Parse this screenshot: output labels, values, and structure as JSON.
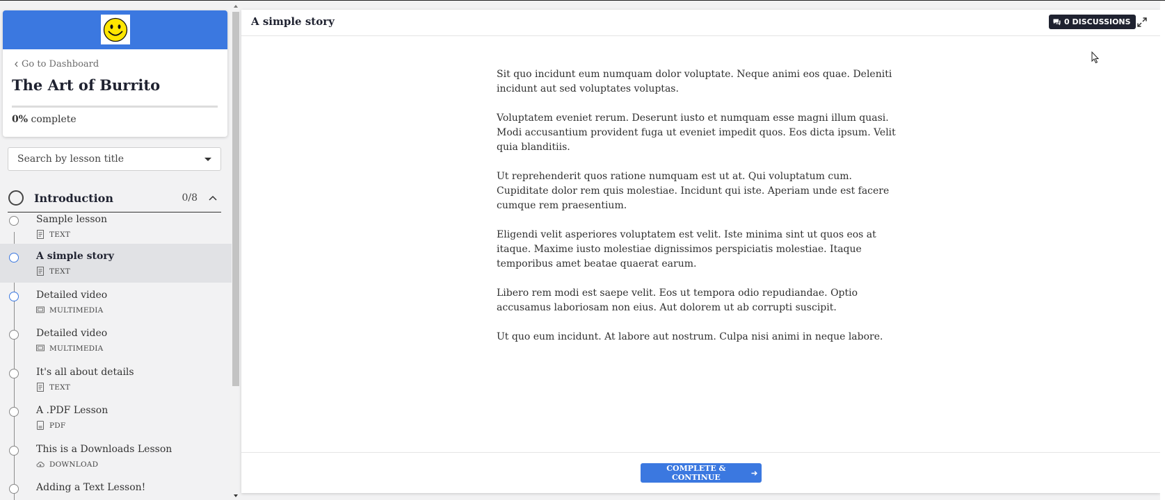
{
  "course": {
    "back_link": "Go to Dashboard",
    "title": "The Art of Burrito",
    "progress_percent": "0%",
    "progress_suffix": "complete",
    "progress_value": 0
  },
  "search": {
    "placeholder": "Search by lesson title"
  },
  "chapter": {
    "title": "Introduction",
    "count": "0/8"
  },
  "lessons": [
    {
      "name": "Sample lesson",
      "type": "TEXT",
      "icon": "document-icon"
    },
    {
      "name": "A simple story",
      "type": "TEXT",
      "icon": "document-icon"
    },
    {
      "name": "Detailed video",
      "type": "MULTIMEDIA",
      "icon": "monitor-icon"
    },
    {
      "name": "Detailed video",
      "type": "MULTIMEDIA",
      "icon": "monitor-icon"
    },
    {
      "name": "It's all about details",
      "type": "TEXT",
      "icon": "document-icon"
    },
    {
      "name": "A .PDF Lesson",
      "type": "PDF",
      "icon": "pdf-icon"
    },
    {
      "name": "This is a Downloads Lesson",
      "type": "DOWNLOAD",
      "icon": "cloud-download-icon"
    },
    {
      "name": "Adding a Text Lesson!",
      "type": "",
      "icon": ""
    }
  ],
  "header": {
    "lesson_title": "A simple story",
    "discussions_label": "0 DISCUSSIONS"
  },
  "content": {
    "paragraphs": [
      "Sit quo incidunt eum numquam dolor voluptate. Neque animi eos quae. Deleniti incidunt aut sed voluptates voluptas.",
      "Voluptatem eveniet rerum. Deserunt iusto et numquam esse magni illum quasi. Modi accusantium provident fuga ut eveniet impedit quos. Eos dicta ipsum. Velit quia blanditiis.",
      "Ut reprehenderit quos ratione numquam est ut at. Qui voluptatum cum. Cupiditate dolor rem quis molestiae. Incidunt qui iste. Aperiam unde est facere cumque rem praesentium.",
      "Eligendi velit asperiores voluptatem est velit. Iste minima sint ut quos eos at itaque. Maxime iusto molestiae dignissimos perspiciatis molestiae. Itaque temporibus amet beatae quaerat earum.",
      "Libero rem modi est saepe velit. Eos ut tempora odio repudiandae. Optio accusamus laboriosam non eius. Aut dolorem ut ab corrupti suscipit.",
      "Ut quo eum incidunt. At labore aut nostrum. Culpa nisi animi in neque labore."
    ]
  },
  "footer": {
    "continue_label": "COMPLETE & CONTINUE"
  },
  "colors": {
    "accent": "#3b78e0",
    "dark": "#1f2230",
    "active_row": "#e1e2e5"
  }
}
